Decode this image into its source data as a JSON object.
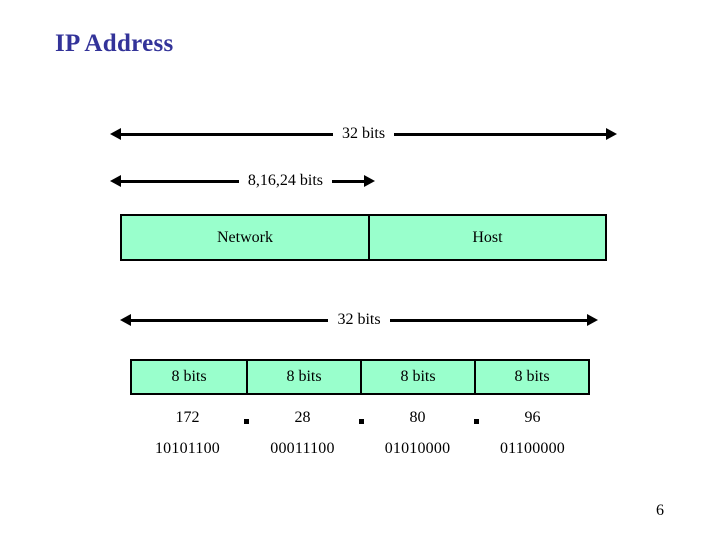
{
  "slide": {
    "title": "IP Address",
    "page_number": "6",
    "title_color": "#333399",
    "field_fill_color": "#99FFCC",
    "line_color": "#000000",
    "background_color": "#FFFFFF"
  },
  "measures": {
    "top_total": "32 bits",
    "top_prefix": "8,16,24 bits",
    "lower_total": "32 bits"
  },
  "classful_fields": [
    {
      "label": "Network"
    },
    {
      "label": "Host"
    }
  ],
  "octet_boxes": [
    {
      "label": "8 bits"
    },
    {
      "label": "8 bits"
    },
    {
      "label": "8 bits"
    },
    {
      "label": "8 bits"
    }
  ],
  "address": {
    "decimal": [
      "172",
      "28",
      "80",
      "96"
    ],
    "binary": [
      "10101100",
      "00011100",
      "01010000",
      "01100000"
    ],
    "separator": "."
  }
}
